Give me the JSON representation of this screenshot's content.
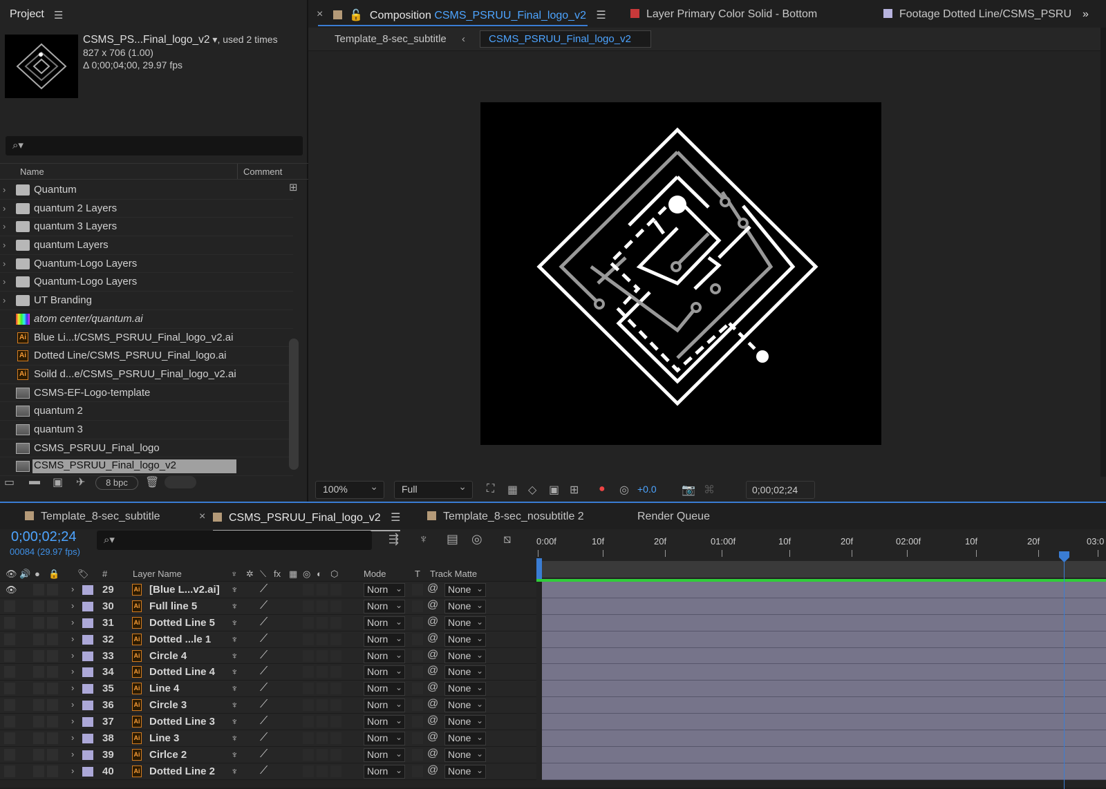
{
  "project": {
    "title": "Project",
    "item_name": "CSMS_PS...Final_logo_v2",
    "used": ", used 2 times",
    "dims": "827 x 706 (1.00)",
    "duration": "Δ 0;00;04;00, 29.97 fps",
    "col_name": "Name",
    "col_comment": "Comment",
    "items": [
      {
        "type": "folder",
        "label": "Quantum"
      },
      {
        "type": "folder",
        "label": "quantum 2 Layers"
      },
      {
        "type": "folder",
        "label": "quantum 3 Layers"
      },
      {
        "type": "folder",
        "label": "quantum Layers"
      },
      {
        "type": "folder",
        "label": "Quantum-Logo Layers"
      },
      {
        "type": "folder",
        "label": "Quantum-Logo Layers"
      },
      {
        "type": "folder",
        "label": "UT Branding"
      },
      {
        "type": "footage",
        "label": "atom center/quantum.ai"
      },
      {
        "type": "ai",
        "label": "Blue Li...t/CSMS_PSRUU_Final_logo_v2.ai"
      },
      {
        "type": "ai",
        "label": "Dotted Line/CSMS_PSRUU_Final_logo.ai"
      },
      {
        "type": "ai",
        "label": "Soild d...e/CSMS_PSRUU_Final_logo_v2.ai"
      },
      {
        "type": "comp",
        "label": "CSMS-EF-Logo-template"
      },
      {
        "type": "comp",
        "label": "quantum 2"
      },
      {
        "type": "comp",
        "label": "quantum 3"
      },
      {
        "type": "comp",
        "label": "CSMS_PSRUU_Final_logo"
      },
      {
        "type": "comp",
        "label": "CSMS_PSRUU_Final_logo_v2",
        "selected": true
      }
    ],
    "bpc": "8 bpc"
  },
  "viewer": {
    "tab_prefix": "Composition",
    "tab_comp": "CSMS_PSRUU_Final_logo_v2",
    "tab2": "Layer Primary Color Solid - Bottom",
    "tab3": "Footage Dotted Line/CSMS_PSRU",
    "sub1": "Template_8-sec_subtitle",
    "sub2": "CSMS_PSRUU_Final_logo_v2",
    "zoom": "100%",
    "resolution": "Full",
    "exposure": "+0.0",
    "timecode": "0;00;02;24",
    "colors": {
      "tab_swatch": "#b49a78",
      "tab2_swatch": "#c8393a",
      "tab3_swatch": "#b7b3de"
    }
  },
  "timeline": {
    "tabs": [
      "Template_8-sec_subtitle",
      "CSMS_PSRUU_Final_logo_v2",
      "Template_8-sec_nosubtitle 2",
      "Render Queue"
    ],
    "current_time": "0;00;02;24",
    "fps": "00084 (29.97 fps)",
    "col_num": "#",
    "col_layer": "Layer Name",
    "col_mode": "Mode",
    "col_t": "T",
    "col_matte": "Track Matte",
    "ruler": [
      "0:00f",
      "10f",
      "20f",
      "01:00f",
      "10f",
      "20f",
      "02:00f",
      "10f",
      "20f",
      "03:0"
    ],
    "layers": [
      {
        "num": "29",
        "name": "[Blue L...v2.ai]",
        "mode": "Norn",
        "matte": "None",
        "visible": true
      },
      {
        "num": "30",
        "name": "Full line 5",
        "mode": "Norn",
        "matte": "None"
      },
      {
        "num": "31",
        "name": "Dotted Line 5",
        "mode": "Norn",
        "matte": "None"
      },
      {
        "num": "32",
        "name": "Dotted ...le 1",
        "mode": "Norn",
        "matte": "None"
      },
      {
        "num": "33",
        "name": "Circle 4",
        "mode": "Norn",
        "matte": "None"
      },
      {
        "num": "34",
        "name": "Dotted Line 4",
        "mode": "Norn",
        "matte": "None"
      },
      {
        "num": "35",
        "name": "Line 4",
        "mode": "Norn",
        "matte": "None"
      },
      {
        "num": "36",
        "name": "Circle 3",
        "mode": "Norn",
        "matte": "None"
      },
      {
        "num": "37",
        "name": "Dotted Line 3",
        "mode": "Norn",
        "matte": "None"
      },
      {
        "num": "38",
        "name": "Line 3",
        "mode": "Norn",
        "matte": "None"
      },
      {
        "num": "39",
        "name": "Cirlce 2",
        "mode": "Norn",
        "matte": "None"
      },
      {
        "num": "40",
        "name": "Dotted Line 2",
        "mode": "Norn",
        "matte": "None"
      }
    ]
  }
}
